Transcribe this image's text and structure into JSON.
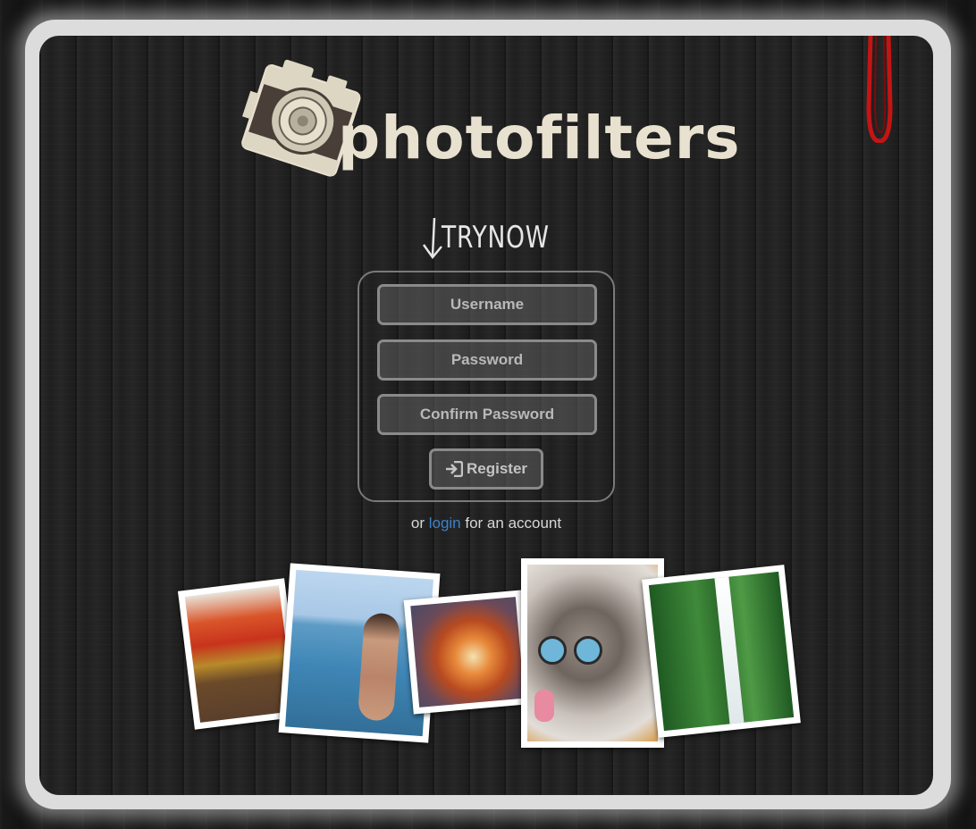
{
  "brand": {
    "name": "photofilters",
    "logo_icon": "camera-icon",
    "strap_icon": "camera-strap-icon"
  },
  "trynow": {
    "text": "TRYNOW",
    "arrow_icon": "arrow-down-icon"
  },
  "form": {
    "username_placeholder": "Username",
    "password_placeholder": "Password",
    "confirm_placeholder": "Confirm Password",
    "register_label": "Register",
    "register_icon": "sign-in-icon"
  },
  "alt": {
    "prefix": "or",
    "link": "login",
    "suffix": "for an account"
  },
  "gallery": [
    {
      "name": "autumn-lake-photo"
    },
    {
      "name": "beach-woman-photo"
    },
    {
      "name": "fire-burst-photo"
    },
    {
      "name": "kitten-photo"
    },
    {
      "name": "waterfall-photo"
    }
  ],
  "colors": {
    "link": "#3b82c8",
    "frame": "#dcdcdc",
    "strap": "#c41414",
    "logo_text": "#e8e1cf"
  }
}
